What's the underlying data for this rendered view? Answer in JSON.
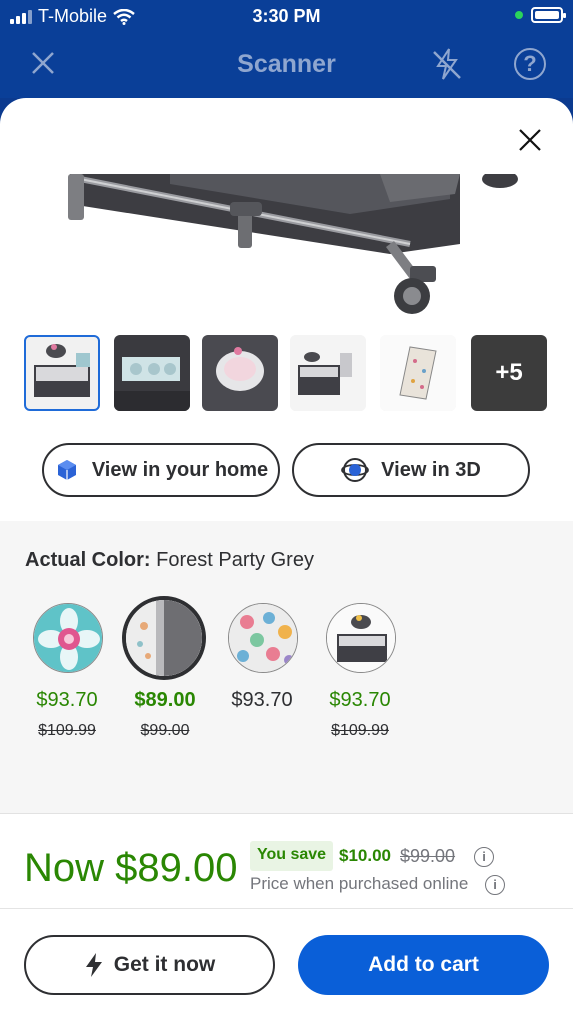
{
  "status": {
    "carrier": "T-Mobile",
    "time": "3:30 PM"
  },
  "navbar": {
    "title": "Scanner",
    "icons": [
      "close-icon",
      "flash-off-icon",
      "help-icon"
    ]
  },
  "gallery": {
    "more_count": "+5",
    "selected_index": 0
  },
  "actions": {
    "view_home": "View in your home",
    "view_3d": "View in 3D"
  },
  "color": {
    "label": "Actual Color:",
    "value": "Forest Party Grey",
    "options": [
      {
        "price": "$93.70",
        "was": "$109.99"
      },
      {
        "price": "$89.00",
        "was": "$99.00"
      },
      {
        "price": "$93.70",
        "was": ""
      },
      {
        "price": "$93.70",
        "was": "$109.99"
      }
    ]
  },
  "pricing": {
    "now": "Now $89.00",
    "you_save_label": "You save",
    "save_amount": "$10.00",
    "old_price": "$99.00",
    "online_note": "Price when purchased online"
  },
  "buttons": {
    "get_it_now": "Get it now",
    "add_to_cart": "Add to cart"
  },
  "colors_theme": {
    "brand_blue": "#0a3f98",
    "primary_button": "#0a5fd8",
    "price_green": "#2a8703"
  }
}
